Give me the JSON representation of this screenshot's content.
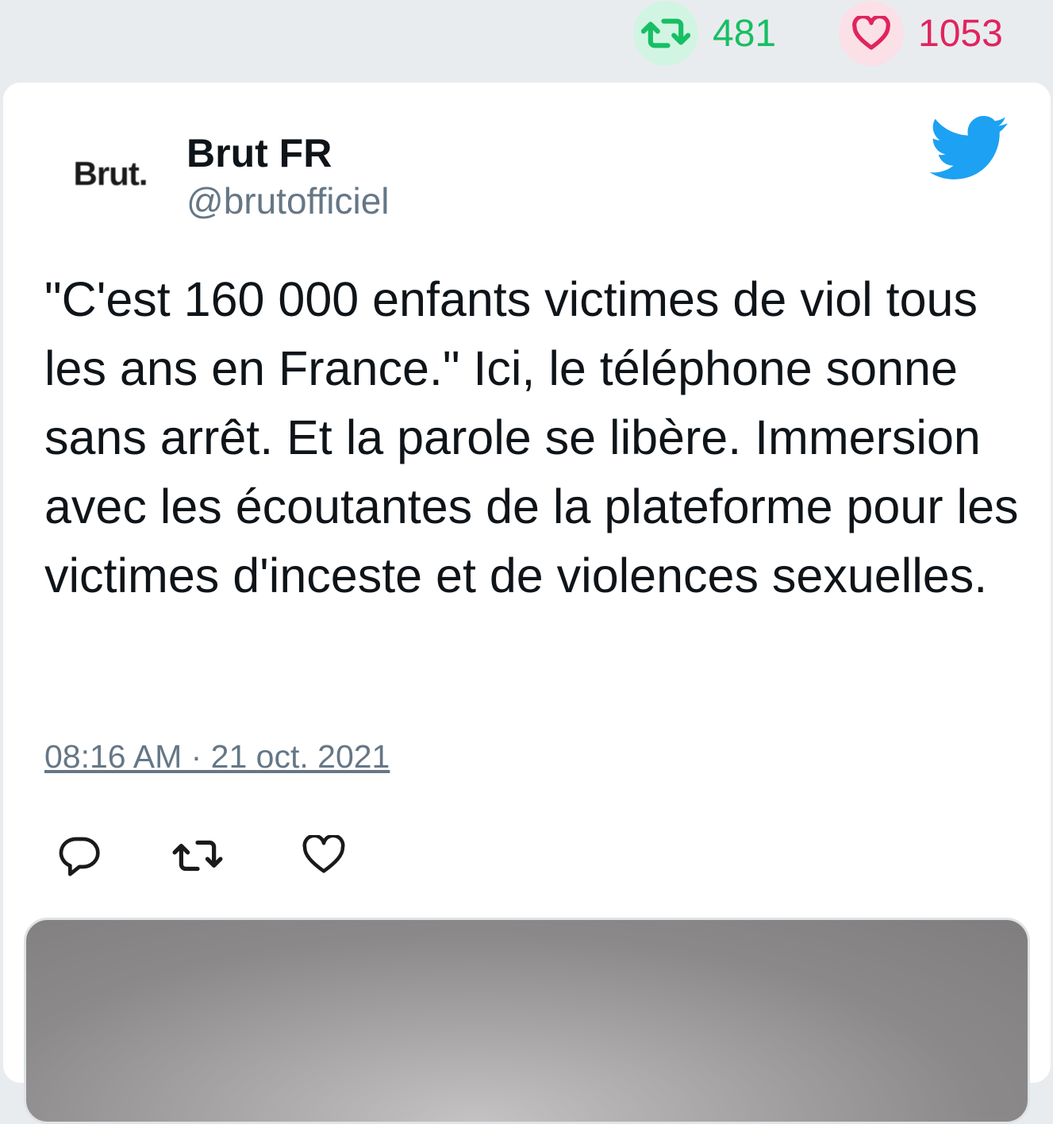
{
  "stats": {
    "retweets": "481",
    "likes": "1053",
    "retweet_color": "#17bf63",
    "like_color": "#e0245e",
    "retweet_icon": "retweet-icon",
    "like_icon": "heart-icon"
  },
  "tweet": {
    "avatar_text": "Brut.",
    "display_name": "Brut FR",
    "handle": "@brutofficiel",
    "text": "\"C'est 160 000 enfants victimes de viol tous les ans en France.\" Ici, le téléphone sonne sans arrêt. Et la parole se libère. Immersion avec les écoutantes de la plateforme pour les victimes d'inceste et de violences sexuelles.",
    "timestamp": "08:16 AM · 21 oct. 2021",
    "brand_icon": "twitter-bird-icon",
    "brand_color": "#1da1f2"
  },
  "actions": {
    "reply_icon": "reply-icon",
    "retweet_icon": "retweet-icon",
    "like_icon": "heart-icon"
  },
  "media": {
    "description_icon": "video-thumbnail"
  }
}
